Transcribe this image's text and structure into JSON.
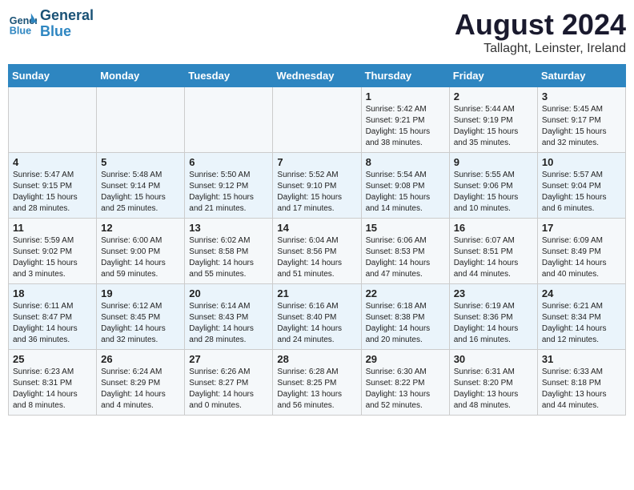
{
  "header": {
    "logo_line1": "General",
    "logo_line2": "Blue",
    "month": "August 2024",
    "location": "Tallaght, Leinster, Ireland"
  },
  "days_of_week": [
    "Sunday",
    "Monday",
    "Tuesday",
    "Wednesday",
    "Thursday",
    "Friday",
    "Saturday"
  ],
  "weeks": [
    [
      {
        "day": "",
        "content": ""
      },
      {
        "day": "",
        "content": ""
      },
      {
        "day": "",
        "content": ""
      },
      {
        "day": "",
        "content": ""
      },
      {
        "day": "1",
        "content": "Sunrise: 5:42 AM\nSunset: 9:21 PM\nDaylight: 15 hours\nand 38 minutes."
      },
      {
        "day": "2",
        "content": "Sunrise: 5:44 AM\nSunset: 9:19 PM\nDaylight: 15 hours\nand 35 minutes."
      },
      {
        "day": "3",
        "content": "Sunrise: 5:45 AM\nSunset: 9:17 PM\nDaylight: 15 hours\nand 32 minutes."
      }
    ],
    [
      {
        "day": "4",
        "content": "Sunrise: 5:47 AM\nSunset: 9:15 PM\nDaylight: 15 hours\nand 28 minutes."
      },
      {
        "day": "5",
        "content": "Sunrise: 5:48 AM\nSunset: 9:14 PM\nDaylight: 15 hours\nand 25 minutes."
      },
      {
        "day": "6",
        "content": "Sunrise: 5:50 AM\nSunset: 9:12 PM\nDaylight: 15 hours\nand 21 minutes."
      },
      {
        "day": "7",
        "content": "Sunrise: 5:52 AM\nSunset: 9:10 PM\nDaylight: 15 hours\nand 17 minutes."
      },
      {
        "day": "8",
        "content": "Sunrise: 5:54 AM\nSunset: 9:08 PM\nDaylight: 15 hours\nand 14 minutes."
      },
      {
        "day": "9",
        "content": "Sunrise: 5:55 AM\nSunset: 9:06 PM\nDaylight: 15 hours\nand 10 minutes."
      },
      {
        "day": "10",
        "content": "Sunrise: 5:57 AM\nSunset: 9:04 PM\nDaylight: 15 hours\nand 6 minutes."
      }
    ],
    [
      {
        "day": "11",
        "content": "Sunrise: 5:59 AM\nSunset: 9:02 PM\nDaylight: 15 hours\nand 3 minutes."
      },
      {
        "day": "12",
        "content": "Sunrise: 6:00 AM\nSunset: 9:00 PM\nDaylight: 14 hours\nand 59 minutes."
      },
      {
        "day": "13",
        "content": "Sunrise: 6:02 AM\nSunset: 8:58 PM\nDaylight: 14 hours\nand 55 minutes."
      },
      {
        "day": "14",
        "content": "Sunrise: 6:04 AM\nSunset: 8:56 PM\nDaylight: 14 hours\nand 51 minutes."
      },
      {
        "day": "15",
        "content": "Sunrise: 6:06 AM\nSunset: 8:53 PM\nDaylight: 14 hours\nand 47 minutes."
      },
      {
        "day": "16",
        "content": "Sunrise: 6:07 AM\nSunset: 8:51 PM\nDaylight: 14 hours\nand 44 minutes."
      },
      {
        "day": "17",
        "content": "Sunrise: 6:09 AM\nSunset: 8:49 PM\nDaylight: 14 hours\nand 40 minutes."
      }
    ],
    [
      {
        "day": "18",
        "content": "Sunrise: 6:11 AM\nSunset: 8:47 PM\nDaylight: 14 hours\nand 36 minutes."
      },
      {
        "day": "19",
        "content": "Sunrise: 6:12 AM\nSunset: 8:45 PM\nDaylight: 14 hours\nand 32 minutes."
      },
      {
        "day": "20",
        "content": "Sunrise: 6:14 AM\nSunset: 8:43 PM\nDaylight: 14 hours\nand 28 minutes."
      },
      {
        "day": "21",
        "content": "Sunrise: 6:16 AM\nSunset: 8:40 PM\nDaylight: 14 hours\nand 24 minutes."
      },
      {
        "day": "22",
        "content": "Sunrise: 6:18 AM\nSunset: 8:38 PM\nDaylight: 14 hours\nand 20 minutes."
      },
      {
        "day": "23",
        "content": "Sunrise: 6:19 AM\nSunset: 8:36 PM\nDaylight: 14 hours\nand 16 minutes."
      },
      {
        "day": "24",
        "content": "Sunrise: 6:21 AM\nSunset: 8:34 PM\nDaylight: 14 hours\nand 12 minutes."
      }
    ],
    [
      {
        "day": "25",
        "content": "Sunrise: 6:23 AM\nSunset: 8:31 PM\nDaylight: 14 hours\nand 8 minutes."
      },
      {
        "day": "26",
        "content": "Sunrise: 6:24 AM\nSunset: 8:29 PM\nDaylight: 14 hours\nand 4 minutes."
      },
      {
        "day": "27",
        "content": "Sunrise: 6:26 AM\nSunset: 8:27 PM\nDaylight: 14 hours\nand 0 minutes."
      },
      {
        "day": "28",
        "content": "Sunrise: 6:28 AM\nSunset: 8:25 PM\nDaylight: 13 hours\nand 56 minutes."
      },
      {
        "day": "29",
        "content": "Sunrise: 6:30 AM\nSunset: 8:22 PM\nDaylight: 13 hours\nand 52 minutes."
      },
      {
        "day": "30",
        "content": "Sunrise: 6:31 AM\nSunset: 8:20 PM\nDaylight: 13 hours\nand 48 minutes."
      },
      {
        "day": "31",
        "content": "Sunrise: 6:33 AM\nSunset: 8:18 PM\nDaylight: 13 hours\nand 44 minutes."
      }
    ]
  ]
}
